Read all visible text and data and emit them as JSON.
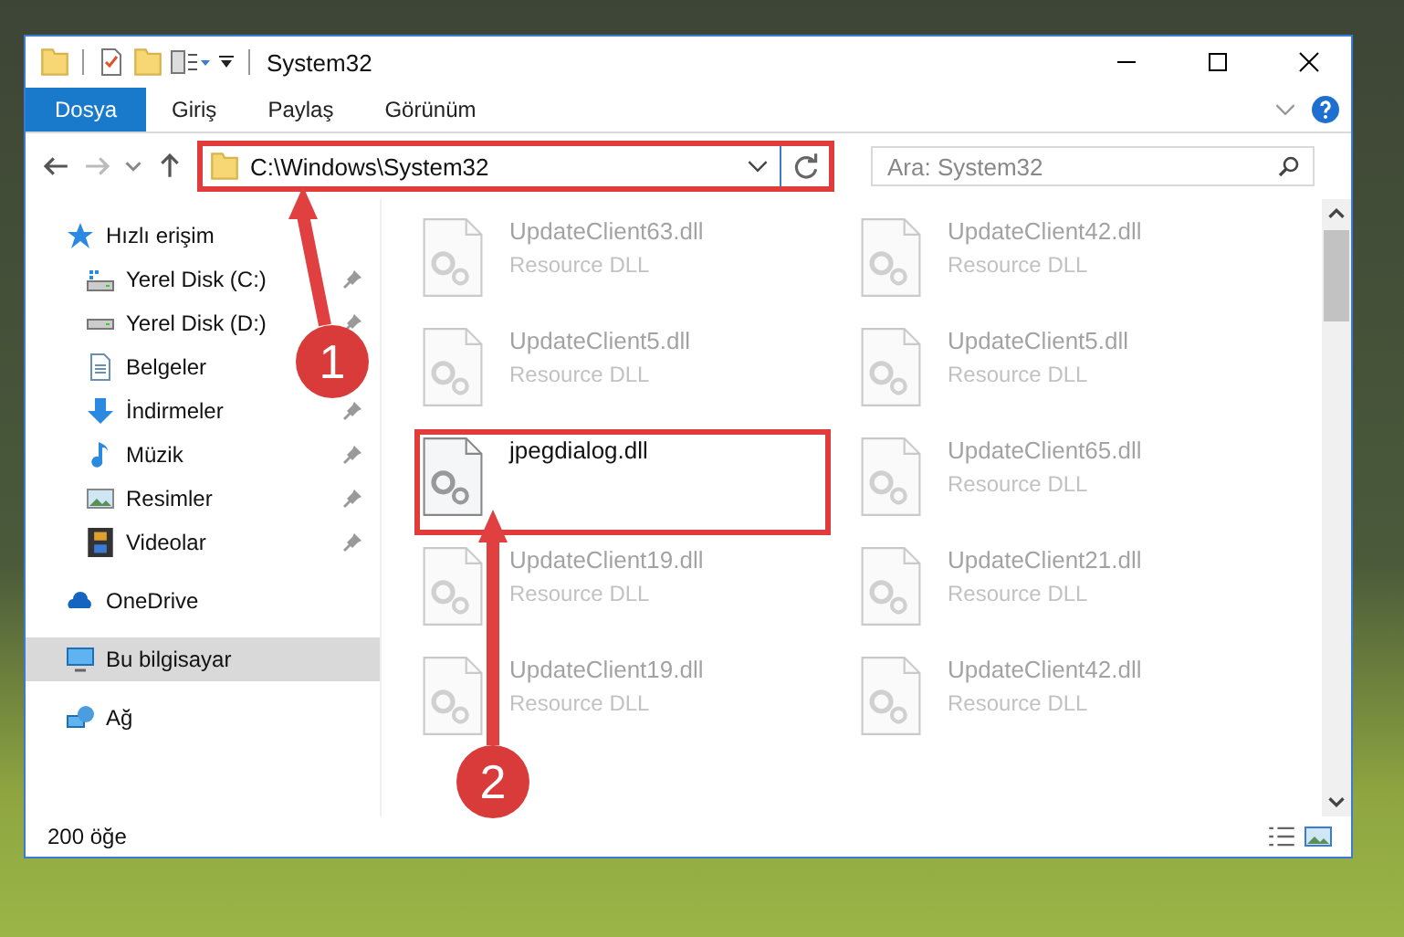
{
  "window": {
    "title": "System32"
  },
  "ribbon_tabs": [
    {
      "label": "Dosya",
      "kind": "file"
    },
    {
      "label": "Giriş",
      "kind": "tab"
    },
    {
      "label": "Paylaş",
      "kind": "tab"
    },
    {
      "label": "Görünüm",
      "kind": "tab"
    }
  ],
  "address_bar": {
    "path": "C:\\Windows\\System32",
    "highlighted": true
  },
  "search": {
    "placeholder": "Ara: System32"
  },
  "sidebar": {
    "items": [
      {
        "label": "Hızlı erişim",
        "selected": false,
        "children": [
          {
            "label": "Yerel Disk (C:)",
            "pinned": true
          },
          {
            "label": "Yerel Disk (D:)",
            "pinned": true
          },
          {
            "label": "Belgeler",
            "pinned": false
          },
          {
            "label": "İndirmeler",
            "pinned": true
          },
          {
            "label": "Müzik",
            "pinned": true
          },
          {
            "label": "Resimler",
            "pinned": true
          },
          {
            "label": "Videolar",
            "pinned": true
          }
        ]
      },
      {
        "label": "OneDrive",
        "selected": false
      },
      {
        "label": "Bu bilgisayar",
        "selected": true
      },
      {
        "label": "Ağ",
        "selected": false
      }
    ]
  },
  "files": [
    {
      "name": "UpdateClient63.dll",
      "type": "Resource DLL",
      "faded": true,
      "highlighted": false
    },
    {
      "name": "UpdateClient42.dll",
      "type": "Resource DLL",
      "faded": true,
      "highlighted": false
    },
    {
      "name": "UpdateClient5.dll",
      "type": "Resource DLL",
      "faded": true,
      "highlighted": false
    },
    {
      "name": "UpdateClient5.dll",
      "type": "Resource DLL",
      "faded": true,
      "highlighted": false
    },
    {
      "name": "jpegdialog.dll",
      "faded": false,
      "highlighted": true
    },
    {
      "name": "UpdateClient65.dll",
      "type": "Resource DLL",
      "faded": true,
      "highlighted": false
    },
    {
      "name": "UpdateClient19.dll",
      "type": "Resource DLL",
      "faded": true,
      "highlighted": false
    },
    {
      "name": "UpdateClient21.dll",
      "type": "Resource DLL",
      "faded": true,
      "highlighted": false
    },
    {
      "name": "UpdateClient19.dll",
      "type": "Resource DLL",
      "faded": true,
      "highlighted": false
    },
    {
      "name": "UpdateClient42.dll",
      "type": "Resource DLL",
      "faded": true,
      "highlighted": false
    }
  ],
  "status_bar": {
    "count": "200 öğe"
  },
  "annotations": [
    {
      "label": "1"
    },
    {
      "label": "2"
    }
  ]
}
